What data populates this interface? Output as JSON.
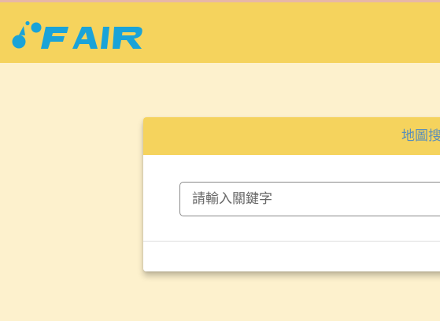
{
  "header": {
    "logo": {
      "text": "FAIR",
      "icon": "droplet-logo-icon",
      "color": "#1aa3d8"
    },
    "background": "#f5d35d"
  },
  "page": {
    "background": "#fdf1cd"
  },
  "card": {
    "header_title": "地圖搜",
    "search": {
      "placeholder": "請輸入關鍵字",
      "value": ""
    }
  }
}
